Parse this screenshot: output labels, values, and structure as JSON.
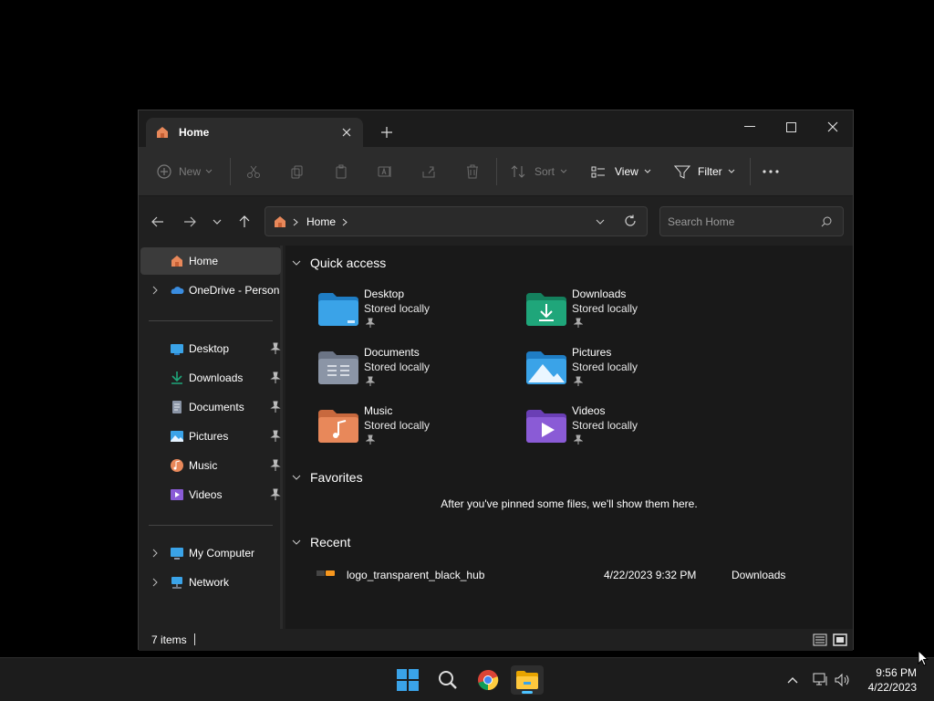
{
  "tab": {
    "title": "Home"
  },
  "toolbar": {
    "new_label": "New",
    "sort_label": "Sort",
    "view_label": "View",
    "filter_label": "Filter"
  },
  "address": {
    "crumb": "Home"
  },
  "search": {
    "placeholder": "Search Home"
  },
  "sidebar": {
    "home": "Home",
    "onedrive": "OneDrive - Persona",
    "desktop": "Desktop",
    "downloads": "Downloads",
    "documents": "Documents",
    "pictures": "Pictures",
    "music": "Music",
    "videos": "Videos",
    "mycomputer": "My Computer",
    "network": "Network"
  },
  "main": {
    "quick_access_title": "Quick access",
    "quick_access": [
      {
        "name": "Desktop",
        "status": "Stored locally"
      },
      {
        "name": "Downloads",
        "status": "Stored locally"
      },
      {
        "name": "Documents",
        "status": "Stored locally"
      },
      {
        "name": "Pictures",
        "status": "Stored locally"
      },
      {
        "name": "Music",
        "status": "Stored locally"
      },
      {
        "name": "Videos",
        "status": "Stored locally"
      }
    ],
    "favorites_title": "Favorites",
    "favorites_empty": "After you've pinned some files, we'll show them here.",
    "recent_title": "Recent",
    "recent": [
      {
        "name": "logo_transparent_black_hub",
        "date": "4/22/2023 9:32 PM",
        "location": "Downloads"
      }
    ]
  },
  "status": {
    "items": "7 items"
  },
  "clock": {
    "time": "9:56 PM",
    "date": "4/22/2023"
  },
  "colors": {
    "accent": "#4cc2ff",
    "folder_blue": "#3aa3e8",
    "folder_green": "#1fa67a",
    "folder_grey": "#8b95a6",
    "folder_orange": "#e8885a",
    "folder_purple": "#8a5bd6"
  }
}
